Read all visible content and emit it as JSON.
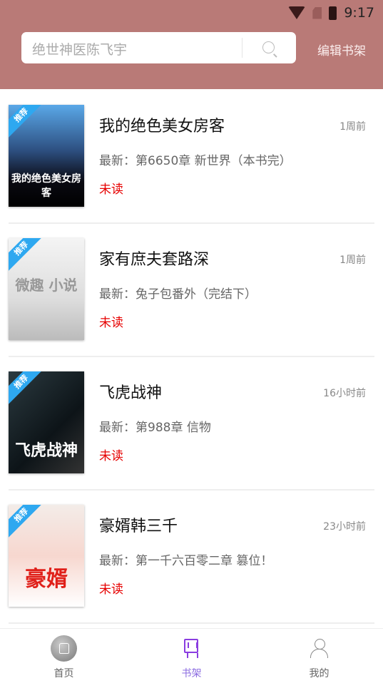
{
  "status": {
    "time": "9:17",
    "icons": [
      "wifi-icon",
      "no-sim-icon",
      "battery-charging-icon"
    ]
  },
  "header": {
    "search_placeholder": "绝世神医陈飞宇",
    "edit_label": "编辑书架",
    "color": "#b97a77"
  },
  "badge": "推荐",
  "books": [
    {
      "title": "我的绝色美女房客",
      "time": "1周前",
      "latest": "最新：第6650章 新世界（本书完）",
      "status": "未读",
      "cover_text": "我的绝色美女房客"
    },
    {
      "title": "家有庶夫套路深",
      "time": "1周前",
      "latest": "最新：兔子包番外（完结下）",
      "status": "未读",
      "cover_text": "微趣 小说"
    },
    {
      "title": "飞虎战神",
      "time": "16小时前",
      "latest": "最新：第988章 信物",
      "status": "未读",
      "cover_text": "飞虎战神"
    },
    {
      "title": "豪婿韩三千",
      "time": "23小时前",
      "latest": "最新：第一千六百零二章 篡位！",
      "status": "未读",
      "cover_text": "豪婿"
    }
  ],
  "nav": [
    {
      "label": "首页",
      "icon": "home-icon"
    },
    {
      "label": "书架",
      "icon": "bookshelf-icon",
      "active": true
    },
    {
      "label": "我的",
      "icon": "user-icon"
    }
  ],
  "colors": {
    "active": "#8a3de0",
    "unread": "#e60000"
  }
}
